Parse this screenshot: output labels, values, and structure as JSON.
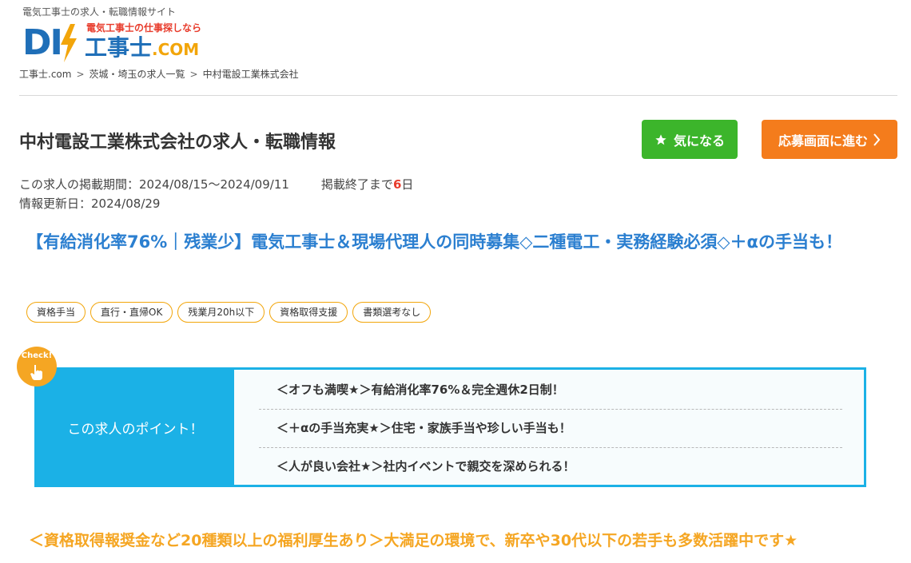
{
  "header": {
    "tagline": "電気工事士の求人・転職情報サイト",
    "logo": {
      "mark": "DI",
      "sub": "電気工事士の仕事探しなら",
      "main": "工事士",
      "dotcom": ".COM",
      "colors": {
        "blue": "#1f6fb8",
        "yellow": "#f2a50a",
        "red": "#e83c2c"
      }
    },
    "breadcrumb": {
      "items": [
        "工事士.com",
        "茨城・埼玉の求人一覧",
        "中村電設工業株式会社"
      ],
      "separator": ">"
    }
  },
  "job": {
    "title": "中村電設工業株式会社の求人・転職情報",
    "favorite_label": "気になる",
    "apply_label": "応募画面に進む",
    "period_text": "この求人の掲載期間：2024/08/15〜2024/09/11",
    "remaining_prefix": "掲載終了まで",
    "remaining_days": "6",
    "remaining_suffix": "日",
    "updated_text": "情報更新日：2024/08/29",
    "headline": "【有給消化率76%｜残業少】電気工事士＆現場代理人の同時募集◇二種電工・実務経験必須◇＋αの手当も！",
    "tags": [
      "資格手当",
      "直行・直帰OK",
      "残業月20h以下",
      "資格取得支援",
      "書類選考なし"
    ],
    "points": {
      "badge": "Check!",
      "label": "この求人のポイント！",
      "items": [
        "＜オフも満喫★＞有給消化率76%＆完全週休2日制！",
        "＜＋αの手当充実★＞住宅・家族手当や珍しい手当も！",
        "＜人が良い会社★＞社内イベントで親交を深められる！"
      ]
    },
    "subheadline": "＜資格取得報奨金など20種類以上の福利厚生あり＞大満足の環境で、新卒や30代以下の若手も多数活躍中です★"
  },
  "colors": {
    "favorite_button": "#3cb52b",
    "apply_button": "#f47c1c",
    "headline": "#2b7fd0",
    "points_accent": "#1bb1e6",
    "subheadline": "#f5a623"
  }
}
